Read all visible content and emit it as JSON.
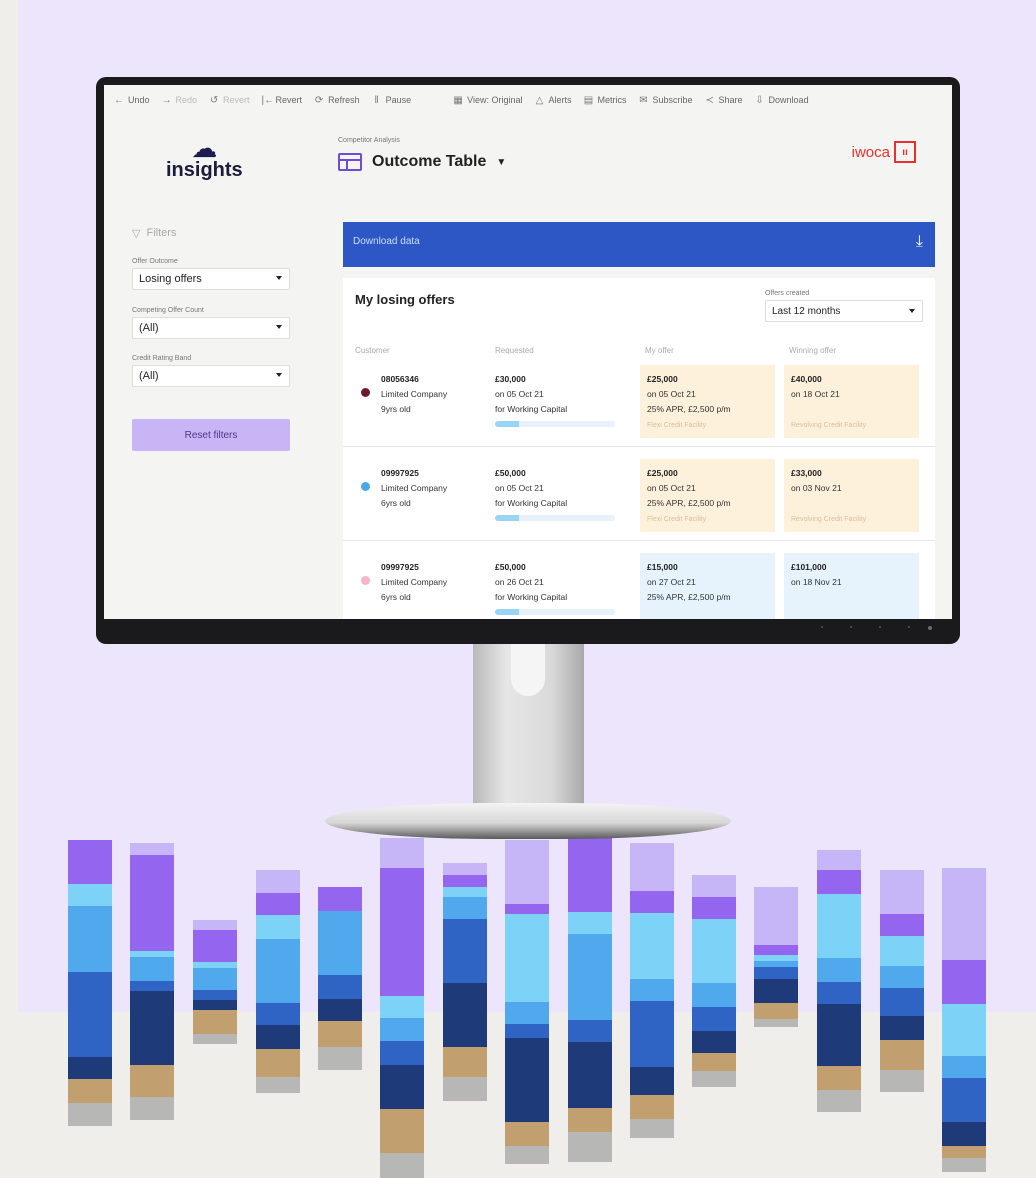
{
  "toolbar": {
    "items": [
      {
        "label": "Undo",
        "icon": "←",
        "faded": false
      },
      {
        "label": "Redo",
        "icon": "→",
        "faded": true
      },
      {
        "label": "Revert",
        "icon": "↺",
        "faded": true
      },
      {
        "label": "Revert",
        "icon": "|←",
        "faded": false
      },
      {
        "label": "Refresh",
        "icon": "⟳",
        "faded": false
      },
      {
        "label": "Pause",
        "icon": "‖",
        "faded": false
      },
      {
        "label": "View: Original",
        "icon": "▦",
        "faded": false
      },
      {
        "label": "Alerts",
        "icon": "△",
        "faded": false
      },
      {
        "label": "Metrics",
        "icon": "▤",
        "faded": false
      },
      {
        "label": "Subscribe",
        "icon": "✉",
        "faded": false
      },
      {
        "label": "Share",
        "icon": "≺",
        "faded": false
      },
      {
        "label": "Download",
        "icon": "⇩",
        "faded": false
      }
    ]
  },
  "logo": {
    "text": "insights",
    "prefix": "CF"
  },
  "filters": {
    "heading": "Filters",
    "offer_outcome": {
      "label": "Offer Outcome",
      "value": "Losing offers"
    },
    "competing_count": {
      "label": "Competing Offer Count",
      "value": "(All)"
    },
    "credit_band": {
      "label": "Credit Rating Band",
      "value": "(All)"
    },
    "reset_label": "Reset filters"
  },
  "header": {
    "breadcrumb": "Competitor Analysis",
    "title": "Outcome Table",
    "brand": "iwoca"
  },
  "download": {
    "label": "Download data"
  },
  "card": {
    "title": "My losing offers",
    "created_label": "Offers created",
    "created_value": "Last 12 months",
    "columns": [
      "Customer",
      "Requested",
      "My offer",
      "Winning offer"
    ],
    "rows": [
      {
        "customer_id": "08056346",
        "customer_type": "Limited Company",
        "customer_age": "9yrs old",
        "dot_color": "#6b1a2e",
        "req_amount": "£30,000",
        "req_date": "on 05 Oct 21",
        "req_purpose": "for Working Capital",
        "my_amount": "£25,000",
        "my_date": "on 05 Oct 21",
        "my_terms": "25% APR, £2,500 p/m",
        "my_product": "Flexi Credit Facility",
        "my_color": "#fdf1dc",
        "win_amount": "£40,000",
        "win_date": "on 18 Oct 21",
        "win_product": "Revolving Credit Facility",
        "win_color": "#fdf1dc"
      },
      {
        "customer_id": "09997925",
        "customer_type": "Limited Company",
        "customer_age": "6yrs old",
        "dot_color": "#4aa8e8",
        "req_amount": "£50,000",
        "req_date": "on 05 Oct 21",
        "req_purpose": "for Working Capital",
        "my_amount": "£25,000",
        "my_date": "on 05 Oct 21",
        "my_terms": "25% APR, £2,500 p/m",
        "my_product": "Flexi Credit Facility",
        "my_color": "#fdf1dc",
        "win_amount": "£33,000",
        "win_date": "on 03 Nov 21",
        "win_product": "Revolving Credit Facility",
        "win_color": "#fdf1dc"
      },
      {
        "customer_id": "09997925",
        "customer_type": "Limited Company",
        "customer_age": "6yrs old",
        "dot_color": "#f6b4c8",
        "req_amount": "£50,000",
        "req_date": "on 26 Oct 21",
        "req_purpose": "for Working Capital",
        "my_amount": "£15,000",
        "my_date": "on 27 Oct 21",
        "my_terms": "25% APR, £2,500 p/m",
        "my_product": "",
        "my_color": "#e6f3fc",
        "win_amount": "£101,000",
        "win_date": "on 18 Nov 21",
        "win_product": "",
        "win_color": "#e6f3fc"
      }
    ]
  },
  "colors": {
    "primary": "#2d57c4",
    "accent": "#6f4cd6",
    "brand": "#e5322d",
    "reset": "#c8b5f6"
  }
}
